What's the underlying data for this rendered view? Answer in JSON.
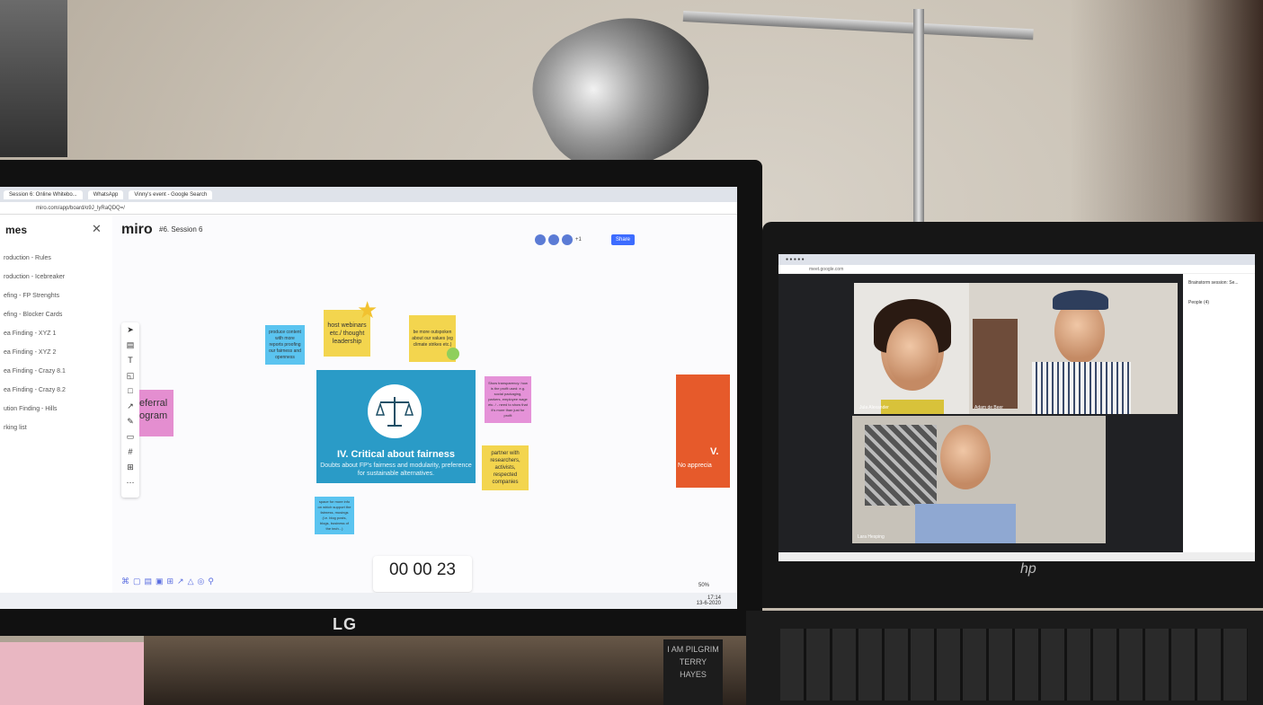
{
  "photo": {
    "monitor_brand": "LG",
    "laptop_brand": "hp",
    "book_text": [
      "I AM PILGRIM",
      "TERRY",
      "HAYES"
    ]
  },
  "monitor_screen": {
    "tabs": [
      "Session 6: Online Whitebo...",
      "WhatsApp",
      "Vinny's event - Google Search"
    ],
    "address": "miro.com/app/board/o9J_lyRaQDQ=/",
    "sidebar": {
      "title": "mes",
      "items": [
        "roduction - Rules",
        "roduction - Icebreaker",
        "efing - FP Strenghts",
        "efing - Blocker Cards",
        "ea Finding - XYZ 1",
        "ea Finding - XYZ 2",
        "ea Finding - Crazy 8.1",
        "ea Finding - Crazy 8.2",
        "ution Finding - Hills",
        "rking list"
      ]
    },
    "board": {
      "logo": "miro",
      "name": "#6. Session 6",
      "share_label": "Share",
      "collaborators_extra": "+1",
      "stickies": [
        {
          "text": "host webinars etc./ thought leadership",
          "color": "#f3d54e"
        },
        {
          "text": "be more outspoken about our values (eg climate strikes etc.)",
          "color": "#f3d54e"
        },
        {
          "text": "produce content with more reports proofing our fairness and openness",
          "color": "#5bc4f0"
        },
        {
          "text": "Show transparency: how is the profit used: e.g. social packaging, parkers, employee wage etc. / - need to show that it's more than just for profit",
          "color": "#e592d8"
        },
        {
          "text": "partner with researchers, activists, respected companies",
          "color": "#f3d54e"
        },
        {
          "text": "space for more info on which support the fairness, musings (i.e. blog posts, blogs, business of the tech...)",
          "color": "#5bc4f0"
        }
      ],
      "main_frame": {
        "title": "IV. Critical about fairness",
        "subtitle": "Doubts about FP's fairness and modularity, preference for sustainable alternatives."
      },
      "right_frame": {
        "title": "V.",
        "subtitle": "No apprecia"
      },
      "left_frame_text": "eferral ogram",
      "timer": "00 00 23",
      "zoom": "50%"
    },
    "taskbar_time": "17:14",
    "taskbar_date": "13-6-2020"
  },
  "laptop_screen": {
    "participants": [
      "Jula Alexander",
      "Adam de Beer",
      "Lara Hesping"
    ],
    "panel_title": "Brainstorm session: Se...",
    "panel_people": "People (4)"
  }
}
